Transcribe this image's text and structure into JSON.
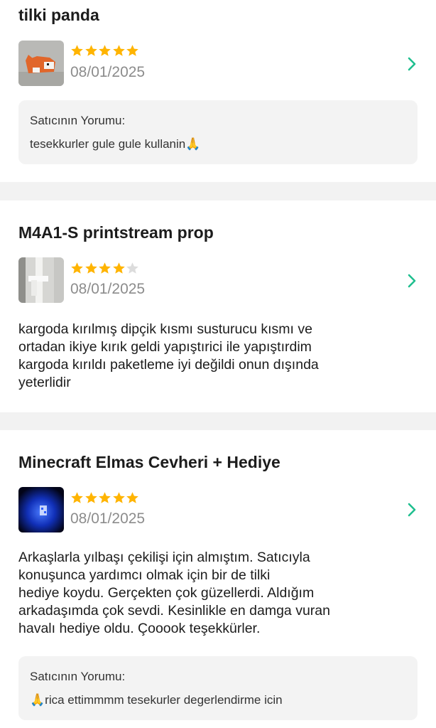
{
  "colors": {
    "star_filled": "#ffb400",
    "star_empty": "#dcdcdc",
    "chevron": "#1fbf8f",
    "separator": "#f2f2f2"
  },
  "reviews": [
    {
      "product_title": "tilki panda",
      "rating": 5,
      "date": "08/01/2025",
      "thumb_icon": "fox-toy-thumbnail",
      "text_lines": [],
      "seller_reply": {
        "label": "Satıcının Yorumu:",
        "text": "tesekkurler gule gule kullanin🙏"
      }
    },
    {
      "product_title": "M4A1-S printstream prop",
      "rating": 4,
      "date": "08/01/2025",
      "thumb_icon": "prop-gun-thumbnail",
      "text_lines": [
        "kargoda kırılmış dipçik kısmı susturucu kısmı ve",
        "ortadan ikiye kırık geldi yapıştırici ile yapıştırdim",
        "kargoda kırıldı paketleme iyi değildi onun dışında",
        "yeterlidir"
      ]
    },
    {
      "product_title": "Minecraft Elmas Cevheri + Hediye",
      "rating": 5,
      "date": "08/01/2025",
      "thumb_icon": "diamond-ore-lamp-thumbnail",
      "text_lines": [
        "Arkaşlarla yılbaşı çekilişi için almıştım. Satıcıyla",
        "konuşunca yardımcı olmak için bir de tilki",
        "hediye koydu. Gerçekten çok güzellerdi. Aldığım",
        "arkadaşımda çok sevdi. Kesinlikle en damga vuran",
        "havalı hediye oldu. Çooook teşekkürler."
      ],
      "seller_reply": {
        "label": "Satıcının Yorumu:",
        "text": "🙏rica ettimmmm tesekurler degerlendirme icin"
      }
    }
  ]
}
